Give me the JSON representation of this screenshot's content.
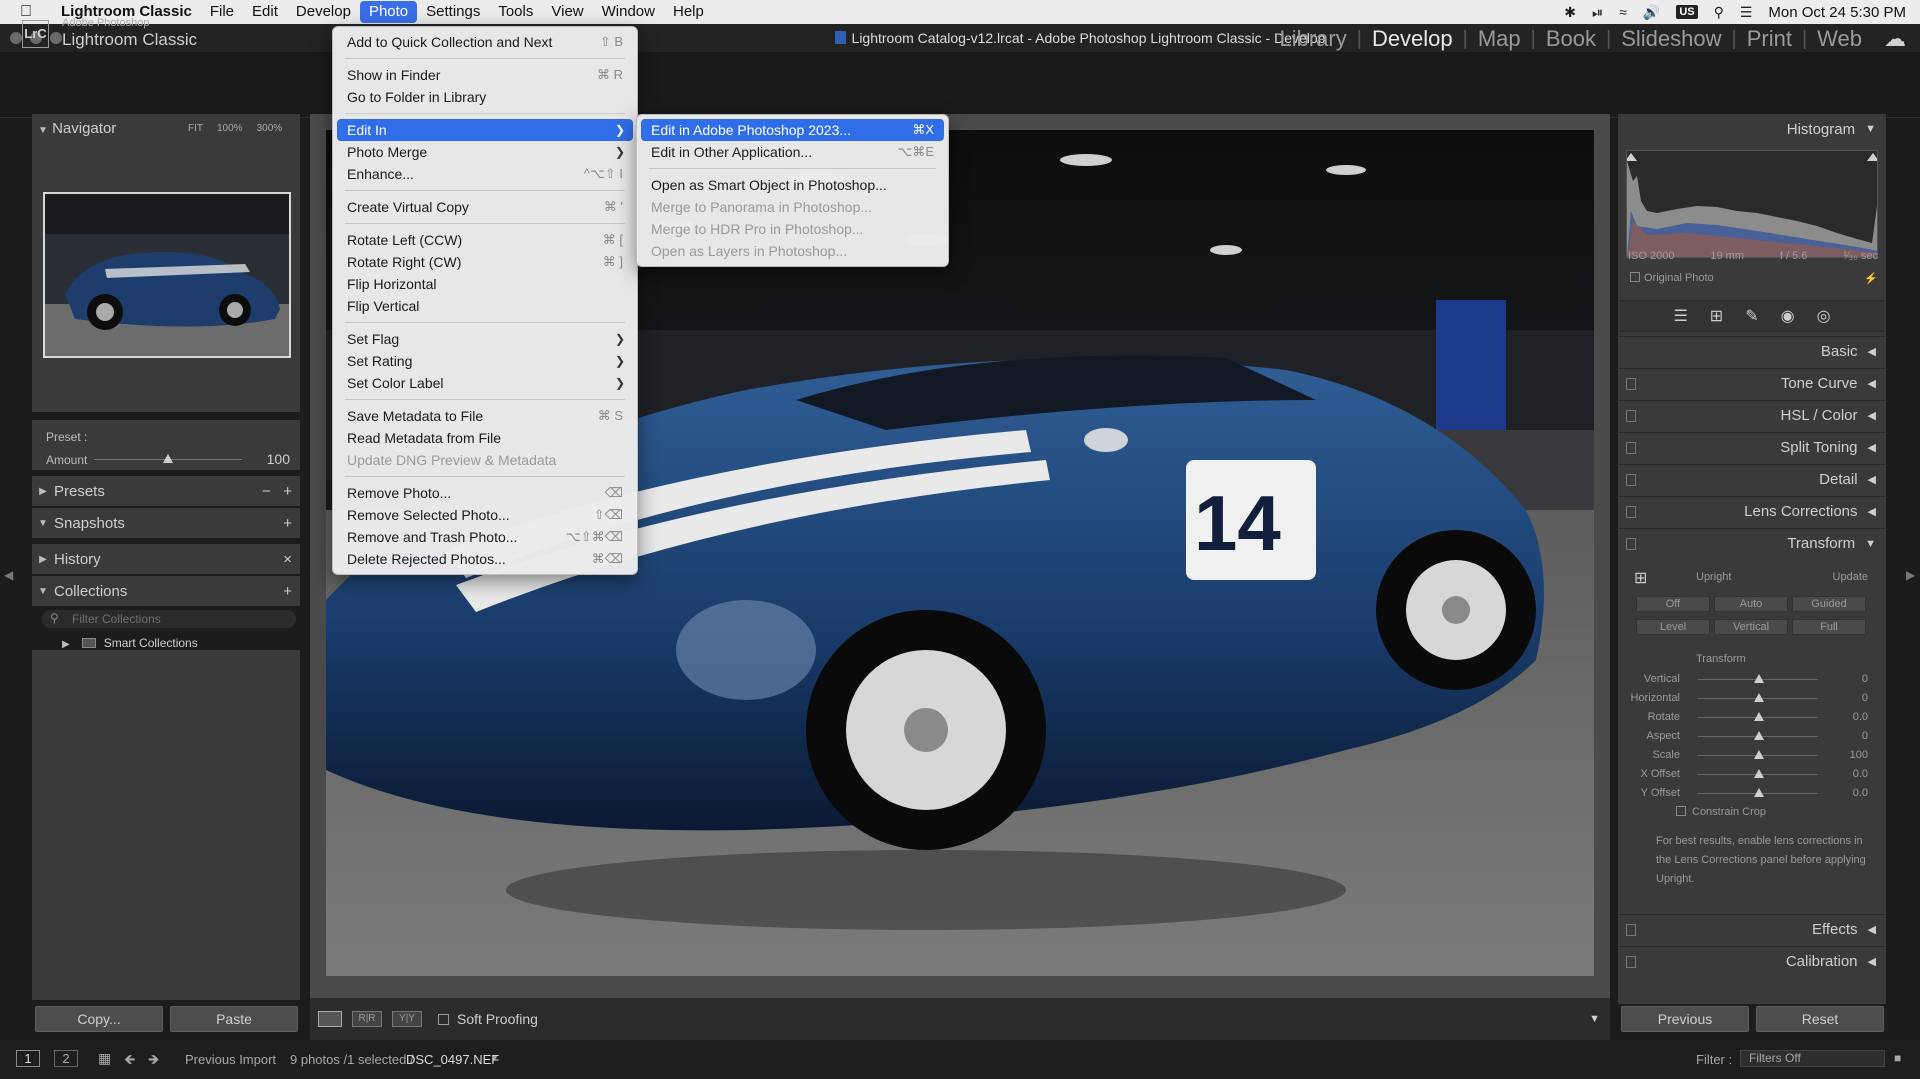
{
  "menubar": {
    "app": "Lightroom Classic",
    "items": [
      "File",
      "Edit",
      "Develop",
      "Photo",
      "Settings",
      "Tools",
      "View",
      "Window",
      "Help"
    ],
    "active": "Photo",
    "clock": "Mon Oct 24  5:30 PM",
    "keyboard_badge": "US"
  },
  "window": {
    "title": "Lightroom Catalog-v12.lrcat - Adobe Photoshop Lightroom Classic - Develop"
  },
  "identity": {
    "line1": "Adobe Photoshop",
    "line2": "Lightroom Classic",
    "badge": "LrC"
  },
  "modules": [
    "Library",
    "Develop",
    "Map",
    "Book",
    "Slideshow",
    "Print",
    "Web"
  ],
  "active_module": "Develop",
  "left_panel": {
    "navigator": {
      "title": "Navigator",
      "zoom": [
        "FIT",
        "100%",
        "300%"
      ]
    },
    "preset": {
      "label": "Preset :",
      "amount_label": "Amount",
      "amount_value": "100",
      "amount_level": 0.5
    },
    "sections": [
      {
        "title": "Presets",
        "icons": [
          "−",
          "+"
        ]
      },
      {
        "title": "Snapshots",
        "icons": [
          "+"
        ]
      },
      {
        "title": "History",
        "icons": [
          "×"
        ]
      },
      {
        "title": "Collections",
        "icons": [
          "+"
        ]
      }
    ],
    "collections_filter_placeholder": "Filter Collections",
    "smart_collections": "Smart Collections",
    "copy_btn": "Copy...",
    "paste_btn": "Paste"
  },
  "toolbar": {
    "soft_proofing": "Soft Proofing"
  },
  "filmstrip": {
    "pages": [
      "1",
      "2"
    ],
    "source": "Previous Import",
    "count": "9 photos /1 selected /",
    "filename": "DSC_0497.NEF",
    "filter_label": "Filter :",
    "filter_value": "Filters Off"
  },
  "right_panel": {
    "histogram": {
      "title": "Histogram",
      "iso": "ISO 2000",
      "focal": "19 mm",
      "aperture": "f / 5.6",
      "shutter": "¹⁄₃₀ sec",
      "original_photo": "Original Photo"
    },
    "sections": [
      "Basic",
      "Tone Curve",
      "HSL / Color",
      "Split Toning",
      "Detail",
      "Lens Corrections",
      "Transform",
      "Effects",
      "Calibration"
    ],
    "transform": {
      "upright_label": "Upright",
      "update_label": "Update",
      "upright_buttons": [
        "Off",
        "Auto",
        "Guided",
        "Level",
        "Vertical",
        "Full"
      ],
      "transform_label": "Transform",
      "sliders": [
        {
          "label": "Vertical",
          "value": "0"
        },
        {
          "label": "Horizontal",
          "value": "0"
        },
        {
          "label": "Rotate",
          "value": "0.0"
        },
        {
          "label": "Aspect",
          "value": "0"
        },
        {
          "label": "Scale",
          "value": "100"
        },
        {
          "label": "X Offset",
          "value": "0.0"
        },
        {
          "label": "Y Offset",
          "value": "0.0"
        }
      ],
      "constrain_crop": "Constrain Crop",
      "hint": "For best results, enable lens corrections in the Lens Corrections panel before applying Upright."
    },
    "previous_btn": "Previous",
    "reset_btn": "Reset"
  },
  "photo_menu": {
    "items": [
      {
        "label": "Add to Quick Collection and Next",
        "shortcut": "⇧ B"
      },
      {
        "sep": true
      },
      {
        "label": "Show in Finder",
        "shortcut": "⌘ R"
      },
      {
        "label": "Go to Folder in Library",
        "shortcut": ""
      },
      {
        "sep": true
      },
      {
        "label": "Edit In",
        "submenu": true,
        "highlight": true
      },
      {
        "label": "Photo Merge",
        "submenu": true
      },
      {
        "label": "Enhance...",
        "shortcut": "^⌥⇧ I"
      },
      {
        "sep": true
      },
      {
        "label": "Create Virtual Copy",
        "shortcut": "⌘ '"
      },
      {
        "sep": true
      },
      {
        "label": "Rotate Left (CCW)",
        "shortcut": "⌘ ["
      },
      {
        "label": "Rotate Right (CW)",
        "shortcut": "⌘ ]"
      },
      {
        "label": "Flip Horizontal",
        "shortcut": ""
      },
      {
        "label": "Flip Vertical",
        "shortcut": ""
      },
      {
        "sep": true
      },
      {
        "label": "Set Flag",
        "submenu": true
      },
      {
        "label": "Set Rating",
        "submenu": true
      },
      {
        "label": "Set Color Label",
        "submenu": true
      },
      {
        "sep": true
      },
      {
        "label": "Save Metadata to File",
        "shortcut": "⌘ S"
      },
      {
        "label": "Read Metadata from File",
        "shortcut": ""
      },
      {
        "label": "Update DNG Preview & Metadata",
        "shortcut": "",
        "disabled": true
      },
      {
        "sep": true
      },
      {
        "label": "Remove Photo...",
        "shortcut": "⌫"
      },
      {
        "label": "Remove Selected Photo...",
        "shortcut": "⇧⌫"
      },
      {
        "label": "Remove and Trash Photo...",
        "shortcut": "⌥⇧⌘⌫"
      },
      {
        "label": "Delete Rejected Photos...",
        "shortcut": "⌘⌫"
      }
    ]
  },
  "edit_in_submenu": {
    "items": [
      {
        "label": "Edit in Adobe Photoshop 2023...",
        "shortcut": "⌘X",
        "highlight": true
      },
      {
        "label": "Edit in Other Application...",
        "shortcut": "⌥⌘E"
      },
      {
        "sep": true
      },
      {
        "label": "Open as Smart Object in Photoshop...",
        "shortcut": ""
      },
      {
        "label": "Merge to Panorama in Photoshop...",
        "shortcut": "",
        "disabled": true
      },
      {
        "label": "Merge to HDR Pro in Photoshop...",
        "shortcut": "",
        "disabled": true
      },
      {
        "label": "Open as Layers in Photoshop...",
        "shortcut": "",
        "disabled": true
      }
    ]
  }
}
